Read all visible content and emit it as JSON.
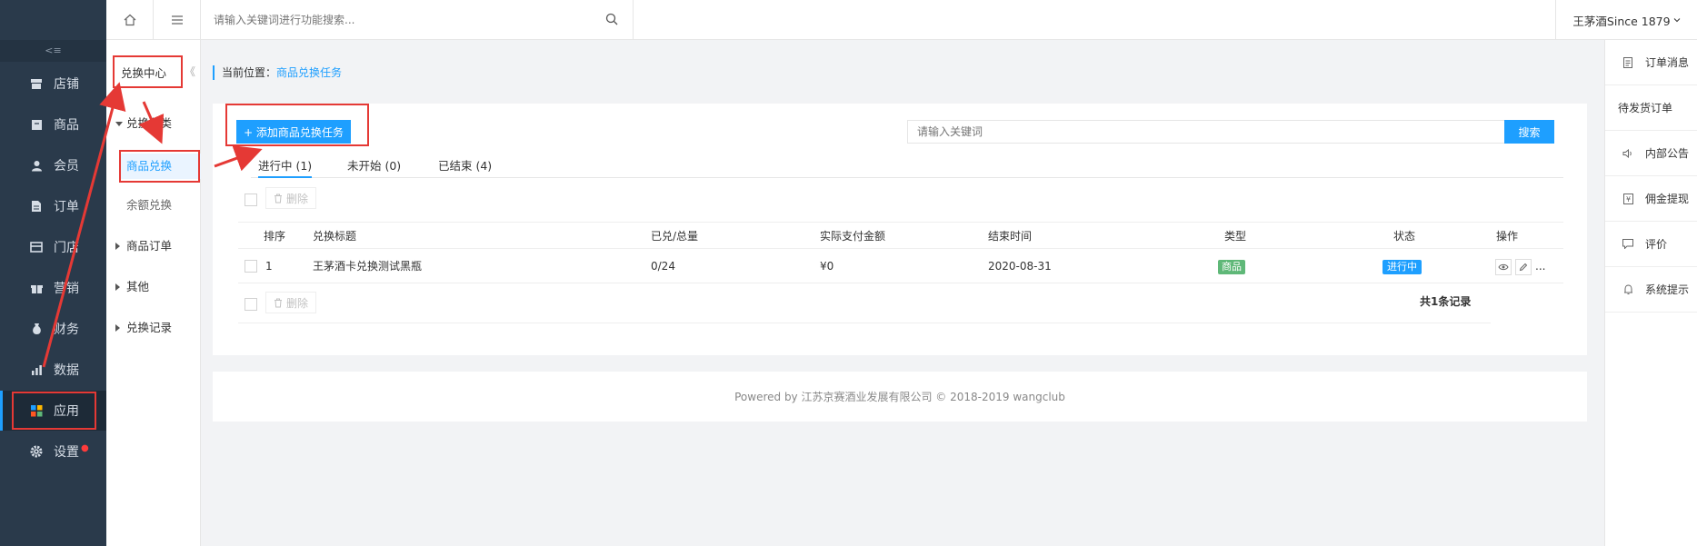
{
  "topbar": {
    "search_placeholder": "请输入关键词进行功能搜索...",
    "user_label": "王茅酒Since 1879"
  },
  "sidebar": {
    "collapse_label": "<≡",
    "items": [
      {
        "label": "店铺",
        "icon": "store-icon"
      },
      {
        "label": "商品",
        "icon": "goods-icon"
      },
      {
        "label": "会员",
        "icon": "member-icon"
      },
      {
        "label": "订单",
        "icon": "order-icon"
      },
      {
        "label": "门店",
        "icon": "shop-icon"
      },
      {
        "label": "营销",
        "icon": "gift-icon"
      },
      {
        "label": "财务",
        "icon": "finance-icon"
      },
      {
        "label": "数据",
        "icon": "data-icon"
      },
      {
        "label": "应用",
        "icon": "apps-icon"
      },
      {
        "label": "设置",
        "icon": "gear-icon"
      }
    ],
    "settings_dot": "●"
  },
  "subpanel": {
    "title": "兑换中心",
    "collapse": "《",
    "groups": [
      {
        "label": "兑换分类"
      },
      {
        "label": "商品兑换"
      },
      {
        "label": "余额兑换"
      },
      {
        "label": "商品订单"
      },
      {
        "label": "其他"
      },
      {
        "label": "兑换记录"
      }
    ]
  },
  "breadcrumb": {
    "prefix": "当前位置：",
    "current": "商品兑换任务"
  },
  "toolbar": {
    "add_label": "+ 添加商品兑换任务",
    "keyword_placeholder": "请输入关键词",
    "search_label": "搜索"
  },
  "tabs": [
    {
      "label": "进行中 (1)"
    },
    {
      "label": "未开始 (0)"
    },
    {
      "label": "已结束 (4)"
    }
  ],
  "bulk": {
    "delete_label": "删除"
  },
  "table": {
    "headers": [
      "排序",
      "兑换标题",
      "已兑/总量",
      "实际支付金额",
      "结束时间",
      "类型",
      "状态",
      "操作"
    ],
    "rows": [
      {
        "order": "1",
        "title": "王茅酒卡兑换测试黑瓶",
        "redeemed": "0/24",
        "amount": "¥0",
        "end_time": "2020-08-31",
        "type": "商品",
        "status": "进行中",
        "more": "..."
      }
    ],
    "type_color": "#5fb878",
    "status_color": "#1e9fff"
  },
  "pagination": {
    "total": "共1条记录"
  },
  "footer": {
    "text": "Powered by 江苏京赛酒业发展有限公司 © 2018-2019 wangclub"
  },
  "rightpanel": {
    "items": [
      {
        "label": "订单消息",
        "icon": "message-icon"
      },
      {
        "label": "待发货订单"
      },
      {
        "label": "内部公告",
        "icon": "speaker-icon"
      },
      {
        "label": "佣金提现",
        "icon": "withdraw-icon"
      },
      {
        "label": "评价",
        "icon": "comment-icon"
      },
      {
        "label": "系统提示",
        "icon": "bell-icon"
      }
    ]
  },
  "colors": {
    "accent": "#1e9fff",
    "sidebar_bg": "#2a3a4b",
    "annotation": "#e53935"
  }
}
